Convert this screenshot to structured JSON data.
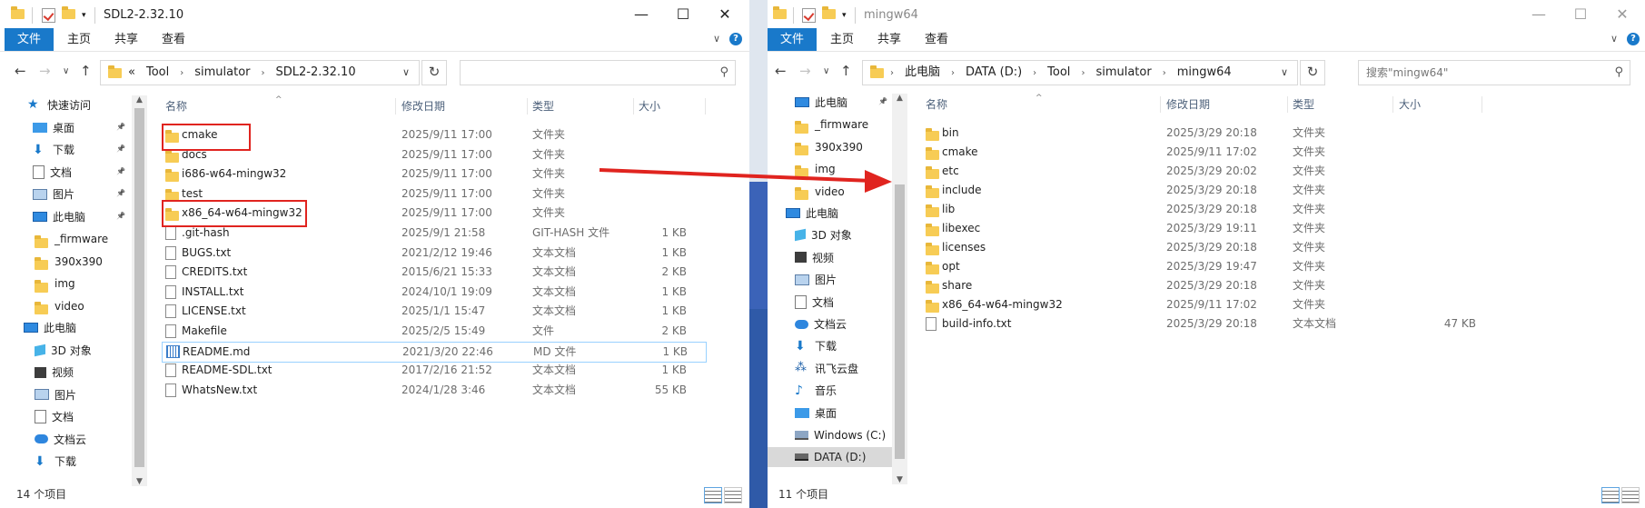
{
  "left": {
    "title": "SDL2-2.32.10",
    "ribbon_tabs": [
      "文件",
      "主页",
      "共享",
      "查看"
    ],
    "breadcrumbs": [
      "«",
      "Tool",
      "simulator",
      "SDL2-2.32.10"
    ],
    "sidebar": [
      {
        "label": "快速访问",
        "icon": "star-icon"
      },
      {
        "label": "桌面",
        "icon": "desktop-icon",
        "pinned": true
      },
      {
        "label": "下载",
        "icon": "download-icon",
        "pinned": true
      },
      {
        "label": "文档",
        "icon": "document-icon",
        "pinned": true
      },
      {
        "label": "图片",
        "icon": "picture-icon",
        "pinned": true
      },
      {
        "label": "此电脑",
        "icon": "computer-icon",
        "pinned": true
      },
      {
        "label": "_firmware",
        "icon": "folder-icon"
      },
      {
        "label": "390x390",
        "icon": "folder-icon"
      },
      {
        "label": "img",
        "icon": "folder-icon"
      },
      {
        "label": "video",
        "icon": "folder-icon"
      },
      {
        "label": "此电脑",
        "icon": "computer-icon"
      },
      {
        "label": "3D 对象",
        "icon": "3d-objects-icon"
      },
      {
        "label": "视频",
        "icon": "video-icon"
      },
      {
        "label": "图片",
        "icon": "picture-icon"
      },
      {
        "label": "文档",
        "icon": "document-icon"
      },
      {
        "label": "文档云",
        "icon": "cloud-icon"
      },
      {
        "label": "下载",
        "icon": "download-icon"
      }
    ],
    "columns": [
      "名称",
      "修改日期",
      "类型",
      "大小"
    ],
    "files": [
      {
        "name": "cmake",
        "date": "2025/9/11 17:00",
        "type": "文件夹",
        "size": "",
        "kind": "folder"
      },
      {
        "name": "docs",
        "date": "2025/9/11 17:00",
        "type": "文件夹",
        "size": "",
        "kind": "folder"
      },
      {
        "name": "i686-w64-mingw32",
        "date": "2025/9/11 17:00",
        "type": "文件夹",
        "size": "",
        "kind": "folder"
      },
      {
        "name": "test",
        "date": "2025/9/11 17:00",
        "type": "文件夹",
        "size": "",
        "kind": "folder"
      },
      {
        "name": "x86_64-w64-mingw32",
        "date": "2025/9/11 17:00",
        "type": "文件夹",
        "size": "",
        "kind": "folder"
      },
      {
        "name": ".git-hash",
        "date": "2025/9/1 21:58",
        "type": "GIT-HASH 文件",
        "size": "1 KB",
        "kind": "file"
      },
      {
        "name": "BUGS.txt",
        "date": "2021/2/12 19:46",
        "type": "文本文档",
        "size": "1 KB",
        "kind": "file"
      },
      {
        "name": "CREDITS.txt",
        "date": "2015/6/21 15:33",
        "type": "文本文档",
        "size": "2 KB",
        "kind": "file"
      },
      {
        "name": "INSTALL.txt",
        "date": "2024/10/1 19:09",
        "type": "文本文档",
        "size": "1 KB",
        "kind": "file"
      },
      {
        "name": "LICENSE.txt",
        "date": "2025/1/1 15:47",
        "type": "文本文档",
        "size": "1 KB",
        "kind": "file"
      },
      {
        "name": "Makefile",
        "date": "2025/2/5 15:49",
        "type": "文件",
        "size": "2 KB",
        "kind": "file"
      },
      {
        "name": "README.md",
        "date": "2021/3/20 22:46",
        "type": "MD 文件",
        "size": "1 KB",
        "kind": "md"
      },
      {
        "name": "README-SDL.txt",
        "date": "2017/2/16 21:52",
        "type": "文本文档",
        "size": "1 KB",
        "kind": "file"
      },
      {
        "name": "WhatsNew.txt",
        "date": "2024/1/28 3:46",
        "type": "文本文档",
        "size": "55 KB",
        "kind": "file"
      }
    ],
    "status": "14 个项目"
  },
  "right": {
    "title": "mingw64",
    "ribbon_tabs": [
      "文件",
      "主页",
      "共享",
      "查看"
    ],
    "breadcrumbs": [
      "此电脑",
      "DATA (D:)",
      "Tool",
      "simulator",
      "mingw64"
    ],
    "search_placeholder": "搜索\"mingw64\"",
    "sidebar": [
      {
        "label": "此电脑",
        "icon": "computer-icon",
        "pinned": true
      },
      {
        "label": "_firmware",
        "icon": "folder-icon"
      },
      {
        "label": "390x390",
        "icon": "folder-icon"
      },
      {
        "label": "img",
        "icon": "folder-icon"
      },
      {
        "label": "video",
        "icon": "folder-icon"
      },
      {
        "label": "此电脑",
        "icon": "computer-icon"
      },
      {
        "label": "3D 对象",
        "icon": "3d-objects-icon"
      },
      {
        "label": "视频",
        "icon": "video-icon"
      },
      {
        "label": "图片",
        "icon": "picture-icon"
      },
      {
        "label": "文档",
        "icon": "document-icon"
      },
      {
        "label": "文档云",
        "icon": "cloud-icon"
      },
      {
        "label": "下载",
        "icon": "download-icon"
      },
      {
        "label": "讯飞云盘",
        "icon": "xunfei-cloud-icon"
      },
      {
        "label": "音乐",
        "icon": "music-icon"
      },
      {
        "label": "桌面",
        "icon": "desktop-icon"
      },
      {
        "label": "Windows (C:)",
        "icon": "drive-c-icon"
      },
      {
        "label": "DATA (D:)",
        "icon": "drive-d-icon",
        "selected": true
      }
    ],
    "columns": [
      "名称",
      "修改日期",
      "类型",
      "大小"
    ],
    "files": [
      {
        "name": "bin",
        "date": "2025/3/29 20:18",
        "type": "文件夹",
        "size": "",
        "kind": "folder"
      },
      {
        "name": "cmake",
        "date": "2025/9/11 17:02",
        "type": "文件夹",
        "size": "",
        "kind": "folder"
      },
      {
        "name": "etc",
        "date": "2025/3/29 20:02",
        "type": "文件夹",
        "size": "",
        "kind": "folder"
      },
      {
        "name": "include",
        "date": "2025/3/29 20:18",
        "type": "文件夹",
        "size": "",
        "kind": "folder"
      },
      {
        "name": "lib",
        "date": "2025/3/29 20:18",
        "type": "文件夹",
        "size": "",
        "kind": "folder"
      },
      {
        "name": "libexec",
        "date": "2025/3/29 19:11",
        "type": "文件夹",
        "size": "",
        "kind": "folder"
      },
      {
        "name": "licenses",
        "date": "2025/3/29 20:18",
        "type": "文件夹",
        "size": "",
        "kind": "folder"
      },
      {
        "name": "opt",
        "date": "2025/3/29 19:47",
        "type": "文件夹",
        "size": "",
        "kind": "folder"
      },
      {
        "name": "share",
        "date": "2025/3/29 20:18",
        "type": "文件夹",
        "size": "",
        "kind": "folder"
      },
      {
        "name": "x86_64-w64-mingw32",
        "date": "2025/9/11 17:02",
        "type": "文件夹",
        "size": "",
        "kind": "folder"
      },
      {
        "name": "build-info.txt",
        "date": "2025/3/29 20:18",
        "type": "文本文档",
        "size": "47 KB",
        "kind": "file"
      }
    ],
    "status": "11 个项目"
  },
  "colors": {
    "accent": "#1979ca",
    "annotation": "#e0241f",
    "selection_border": "#99d1ff"
  }
}
